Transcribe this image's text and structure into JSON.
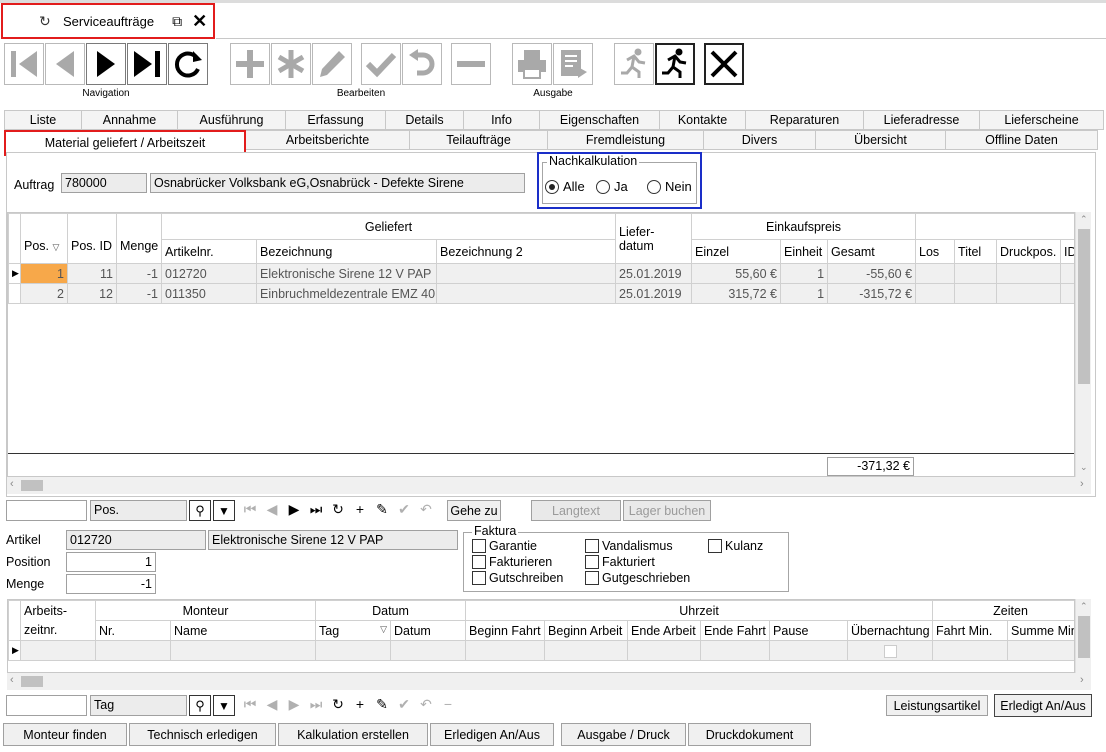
{
  "window_tab": {
    "title": "Serviceaufträge"
  },
  "toolbar": {
    "navigation_label": "Navigation",
    "bearbeiten_label": "Bearbeiten",
    "ausgabe_label": "Ausgabe"
  },
  "tabs_row1": [
    "Liste",
    "Annahme",
    "Ausführung",
    "Erfassung",
    "Details",
    "Info",
    "Eigenschaften",
    "Kontakte",
    "Reparaturen",
    "Lieferadresse",
    "Lieferscheine"
  ],
  "tabs_row2": [
    "Material geliefert / Arbeitszeit",
    "Arbeitsberichte",
    "Teilaufträge",
    "Fremdleistung",
    "Divers",
    "Übersicht",
    "Offline Daten"
  ],
  "auftrag": {
    "label": "Auftrag",
    "number": "780000",
    "description": "Osnabrücker Volksbank eG,Osnabrück - Defekte Sirene"
  },
  "nachkalkulation": {
    "title": "Nachkalkulation",
    "options": [
      "Alle",
      "Ja",
      "Nein"
    ],
    "selected": "Alle"
  },
  "material_grid": {
    "group_headers": {
      "geliefert": "Geliefert",
      "einkaufspreis": "Einkaufspreis",
      "lieferdatum": "Liefer-\ndatum"
    },
    "columns": {
      "pos": "Pos.",
      "pos_id": "Pos. ID",
      "menge": "Menge",
      "artikelnr": "Artikelnr.",
      "bezeichnung": "Bezeichnung",
      "bezeichnung2": "Bezeichnung 2",
      "einzel": "Einzel",
      "einheit": "Einheit",
      "gesamt": "Gesamt",
      "los": "Los",
      "titel": "Titel",
      "druckpos": "Druckpos.",
      "id": "ID"
    },
    "rows": [
      {
        "pos": "1",
        "pos_id": "11",
        "menge": "-1",
        "artikelnr": "012720",
        "bezeichnung": "Elektronische Sirene 12 V PAP",
        "bezeichnung2": "",
        "datum": "25.01.2019",
        "einzel": "55,60 €",
        "einheit": "1",
        "gesamt": "-55,60 €"
      },
      {
        "pos": "2",
        "pos_id": "12",
        "menge": "-1",
        "artikelnr": "011350",
        "bezeichnung": "Einbruchmeldezentrale EMZ 40",
        "bezeichnung2": "",
        "datum": "25.01.2019",
        "einzel": "315,72 €",
        "einheit": "1",
        "gesamt": "-315,72 €"
      }
    ],
    "total": "-371,32 €"
  },
  "nav_bar1": {
    "field_value": "",
    "field_label": "Pos.",
    "gehe_zu": "Gehe zu",
    "langtext": "Langtext",
    "lager_buchen": "Lager buchen"
  },
  "details": {
    "artikel_label": "Artikel",
    "artikel_nr": "012720",
    "artikel_name": "Elektronische Sirene 12 V PAP",
    "position_label": "Position",
    "position_value": "1",
    "menge_label": "Menge",
    "menge_value": "-1"
  },
  "faktura": {
    "title": "Faktura",
    "col1": [
      "Garantie",
      "Fakturieren",
      "Gutschreiben"
    ],
    "col2": [
      "Vandalismus",
      "Fakturiert",
      "Gutgeschrieben"
    ],
    "col3": [
      "Kulanz"
    ]
  },
  "arbeitszeit_grid": {
    "group_headers": {
      "arbeitszeit": "Arbeits-",
      "monteur": "Monteur",
      "datum": "Datum",
      "uhrzeit": "Uhrzeit",
      "zeiten": "Zeiten"
    },
    "columns": {
      "zeitnr": "zeitnr.",
      "nr": "Nr.",
      "name": "Name",
      "tag": "Tag",
      "datum": "Datum",
      "beginn_fahrt": "Beginn Fahrt",
      "beginn_arbeit": "Beginn Arbeit",
      "ende_arbeit": "Ende Arbeit",
      "ende_fahrt": "Ende Fahrt",
      "pause": "Pause",
      "uebernachtung": "Übernachtung",
      "fahrt_min": "Fahrt Min.",
      "summe_min": "Summe Min"
    }
  },
  "nav_bar2": {
    "field_value": "",
    "field_label": "Tag",
    "leistungsartikel": "Leistungsartikel",
    "erledigt": "Erledigt An/Aus"
  },
  "bottom_buttons": [
    "Monteur finden",
    "Technisch erledigen",
    "Kalkulation erstellen",
    "Erledigen An/Aus",
    "Ausgabe / Druck",
    "Druckdokument"
  ]
}
